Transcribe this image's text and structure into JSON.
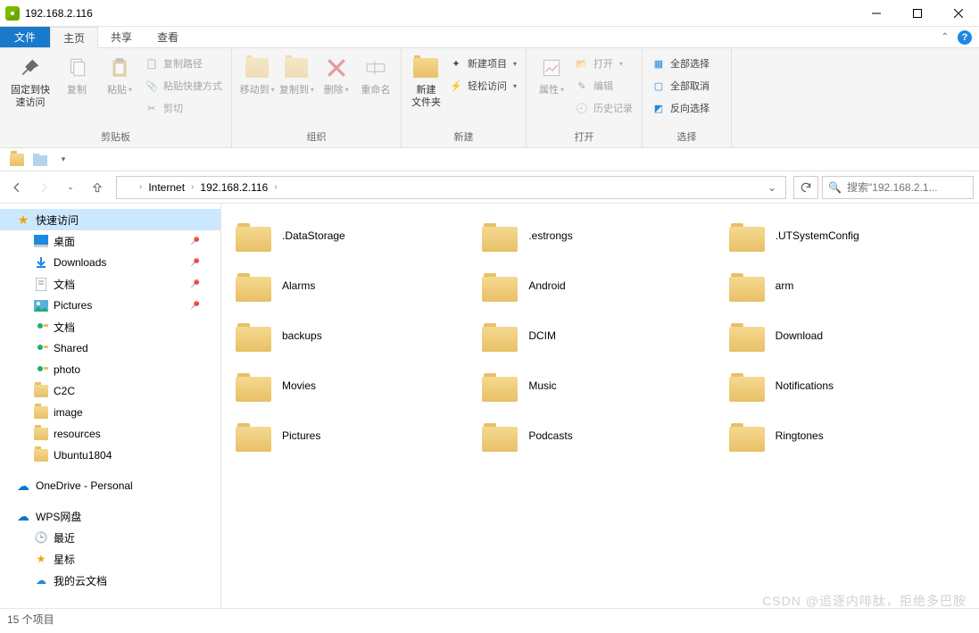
{
  "window": {
    "title": "192.168.2.116"
  },
  "tabs": {
    "file": "文件",
    "home": "主页",
    "share": "共享",
    "view": "查看"
  },
  "ribbon": {
    "clipboard": {
      "label": "剪贴板",
      "pin": "固定到快\n速访问",
      "copy": "复制",
      "paste": "粘贴",
      "copypath": "复制路径",
      "pasteshortcut": "粘贴快捷方式",
      "cut": "剪切"
    },
    "organize": {
      "label": "组织",
      "moveto": "移动到",
      "copyto": "复制到",
      "delete": "删除",
      "rename": "重命名"
    },
    "new": {
      "label": "新建",
      "newfolder": "新建\n文件夹",
      "newitem": "新建项目",
      "easyaccess": "轻松访问"
    },
    "open": {
      "label": "打开",
      "properties": "属性",
      "open": "打开",
      "edit": "编辑",
      "history": "历史记录"
    },
    "select": {
      "label": "选择",
      "selectall": "全部选择",
      "selectnone": "全部取消",
      "invert": "反向选择"
    }
  },
  "breadcrumb": {
    "root": "Internet",
    "current": "192.168.2.116"
  },
  "search": {
    "placeholder": "搜索\"192.168.2.1..."
  },
  "sidebar": {
    "quick": "快速访问",
    "items": [
      {
        "label": "桌面",
        "pin": true,
        "icon": "desktop"
      },
      {
        "label": "Downloads",
        "pin": true,
        "icon": "downloads"
      },
      {
        "label": "文档",
        "pin": true,
        "icon": "documents"
      },
      {
        "label": "Pictures",
        "pin": true,
        "icon": "pictures"
      },
      {
        "label": "文档",
        "pin": false,
        "icon": "folder-sync"
      },
      {
        "label": "Shared",
        "pin": false,
        "icon": "folder-sync"
      },
      {
        "label": "photo",
        "pin": false,
        "icon": "folder-sync"
      },
      {
        "label": "C2C",
        "pin": false,
        "icon": "folder"
      },
      {
        "label": "image",
        "pin": false,
        "icon": "folder"
      },
      {
        "label": "resources",
        "pin": false,
        "icon": "folder"
      },
      {
        "label": "Ubuntu1804",
        "pin": false,
        "icon": "folder"
      }
    ],
    "onedrive": "OneDrive - Personal",
    "wps": "WPS网盘",
    "wps_items": [
      {
        "label": "最近",
        "icon": "clock"
      },
      {
        "label": "星标",
        "icon": "star"
      },
      {
        "label": "我的云文档",
        "icon": "cloud-doc"
      }
    ]
  },
  "folders": [
    ".DataStorage",
    ".estrongs",
    ".UTSystemConfig",
    "Alarms",
    "Android",
    "arm",
    "backups",
    "DCIM",
    "Download",
    "Movies",
    "Music",
    "Notifications",
    "Pictures",
    "Podcasts",
    "Ringtones"
  ],
  "status": {
    "text": "15 个项目"
  },
  "watermark": "CSDN @追逐内啡肽，拒绝多巴胺"
}
